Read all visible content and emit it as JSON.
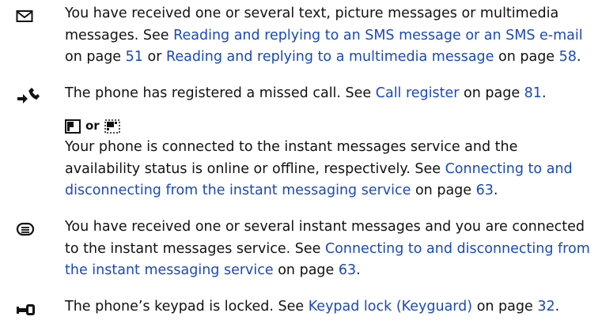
{
  "entries": [
    {
      "icon": "envelope-icon",
      "parts": {
        "t1": "You have received one or several text, picture messages or multimedia messages. See ",
        "l1": "Reading and replying to an SMS message or an SMS e-mail",
        "t2": " on page ",
        "p1": "51",
        "t3": " or ",
        "l2": "Reading and replying to a multimedia message",
        "t4": " on page ",
        "p2": "58",
        "t5": "."
      }
    },
    {
      "icon": "missed-call-icon",
      "parts": {
        "t1": "The phone has registered a missed call. See ",
        "l1": "Call register",
        "t2": " on page ",
        "p1": "81",
        "t3": "."
      }
    },
    {
      "icons": [
        "im-online-icon",
        "im-offline-icon"
      ],
      "or_label": "or",
      "parts": {
        "t1": "Your phone is connected to the instant messages service and the availability status is online or offline, respectively. See ",
        "l1": "Connecting to and disconnecting from the instant messaging service",
        "t2": " on page ",
        "p1": "63",
        "t3": "."
      }
    },
    {
      "icon": "instant-message-icon",
      "parts": {
        "t1": "You have received one or several instant messages and you are connected to the instant messages service. See ",
        "l1": "Connecting to and disconnecting from the instant messaging service",
        "t2": " on page ",
        "p1": "63",
        "t3": "."
      }
    },
    {
      "icon": "keypad-lock-icon",
      "parts": {
        "t1": "The phone’s keypad is locked. See ",
        "l1": "Keypad lock (Keyguard)",
        "t2": " on page ",
        "p1": "32",
        "t3": "."
      }
    }
  ],
  "colors": {
    "link": "#1a49b8",
    "text": "#111111"
  }
}
